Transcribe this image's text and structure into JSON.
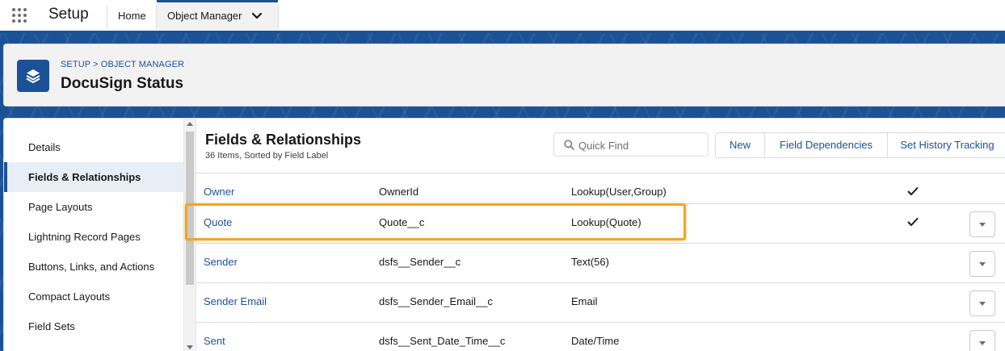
{
  "topnav": {
    "app_name": "Setup",
    "tabs": [
      {
        "label": "Home"
      },
      {
        "label": "Object Manager"
      }
    ]
  },
  "header": {
    "breadcrumb": "SETUP > OBJECT MANAGER",
    "title": "DocuSign Status",
    "icon": "layers-icon"
  },
  "sidebar": {
    "items": [
      {
        "label": "Details"
      },
      {
        "label": "Fields & Relationships"
      },
      {
        "label": "Page Layouts"
      },
      {
        "label": "Lightning Record Pages"
      },
      {
        "label": "Buttons, Links, and Actions"
      },
      {
        "label": "Compact Layouts"
      },
      {
        "label": "Field Sets"
      }
    ],
    "active_index": 1
  },
  "main": {
    "title": "Fields & Relationships",
    "subtitle": "36 Items, Sorted by Field Label",
    "quickfind_placeholder": "Quick Find",
    "buttons": {
      "new": "New",
      "field_dependencies": "Field Dependencies",
      "set_history_tracking": "Set History Tracking"
    },
    "rows": [
      {
        "label": "Owner",
        "api": "OwnerId",
        "type": "Lookup(User,Group)",
        "checked": true,
        "menu": false
      },
      {
        "label": "Quote",
        "api": "Quote__c",
        "type": "Lookup(Quote)",
        "checked": true,
        "menu": true
      },
      {
        "label": "Sender",
        "api": "dsfs__Sender__c",
        "type": "Text(56)",
        "checked": false,
        "menu": true
      },
      {
        "label": "Sender Email",
        "api": "dsfs__Sender_Email__c",
        "type": "Email",
        "checked": false,
        "menu": true
      },
      {
        "label": "Sent",
        "api": "dsfs__Sent_Date_Time__c",
        "type": "Date/Time",
        "checked": false,
        "menu": true
      }
    ]
  },
  "colors": {
    "brand": "#1b5297",
    "highlight": "#f4a422"
  }
}
